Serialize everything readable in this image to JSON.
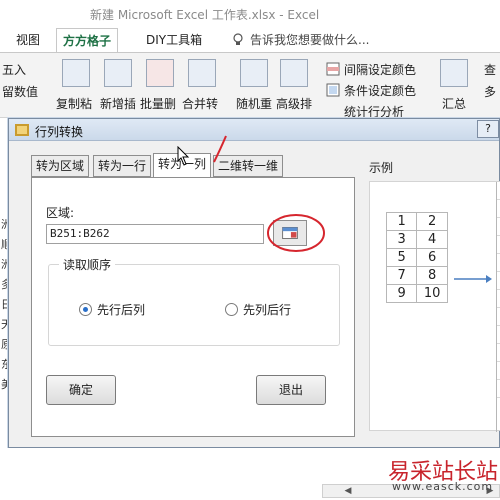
{
  "app": {
    "title": "新建 Microsoft Excel 工作表.xlsx - Excel"
  },
  "ribbon_tabs": [
    "视图",
    "方方格子",
    "DIY工具箱"
  ],
  "active_tab": "方方格子",
  "tellme": "告诉我您想要做什么...",
  "ribbon": {
    "left_partial_1": "五入",
    "left_partial_2": "留数值",
    "copy_paste": "复制粘",
    "new_insert": "新增插",
    "batch_delete": "批量删",
    "merge_convert": "合并转",
    "random_repeat": "随机重",
    "advanced_sort": "高级排",
    "interval_color": "间隔设定颜色",
    "conditional_color": "条件设定颜色",
    "stat_partial": "统计行分析",
    "summary": "汇总",
    "menu_partial_1": "查",
    "menu_partial_2": "多"
  },
  "sheet_chars": [
    "洲",
    "顺",
    "洲",
    "多",
    "日",
    "天",
    "原",
    "东",
    "美"
  ],
  "dialog": {
    "title": "行列转换",
    "help_btn": "?",
    "tabs": [
      "转为区域",
      "转为一行",
      "转为一列",
      "二维转一维"
    ],
    "active_tab": "转为一列",
    "area_label": "区域:",
    "area_value": "B251:B262",
    "read_order_label": "读取顺序",
    "option_row_first": "先行后列",
    "option_col_first": "先列后行",
    "selected_option": "先行后列",
    "ok_label": "确定",
    "exit_label": "退出",
    "example_label": "示例",
    "example_grid": [
      [
        "1",
        "2"
      ],
      [
        "3",
        "4"
      ],
      [
        "5",
        "6"
      ],
      [
        "7",
        "8"
      ],
      [
        "9",
        "10"
      ]
    ]
  },
  "watermark": {
    "cn": "易采站长站",
    "en": "www.easck.com"
  },
  "scrollbar": {
    "left": "◀",
    "right": "▶"
  },
  "colors": {
    "accent": "#1e7145",
    "selection": "#2a6fc9",
    "annotation": "#d6262e"
  }
}
